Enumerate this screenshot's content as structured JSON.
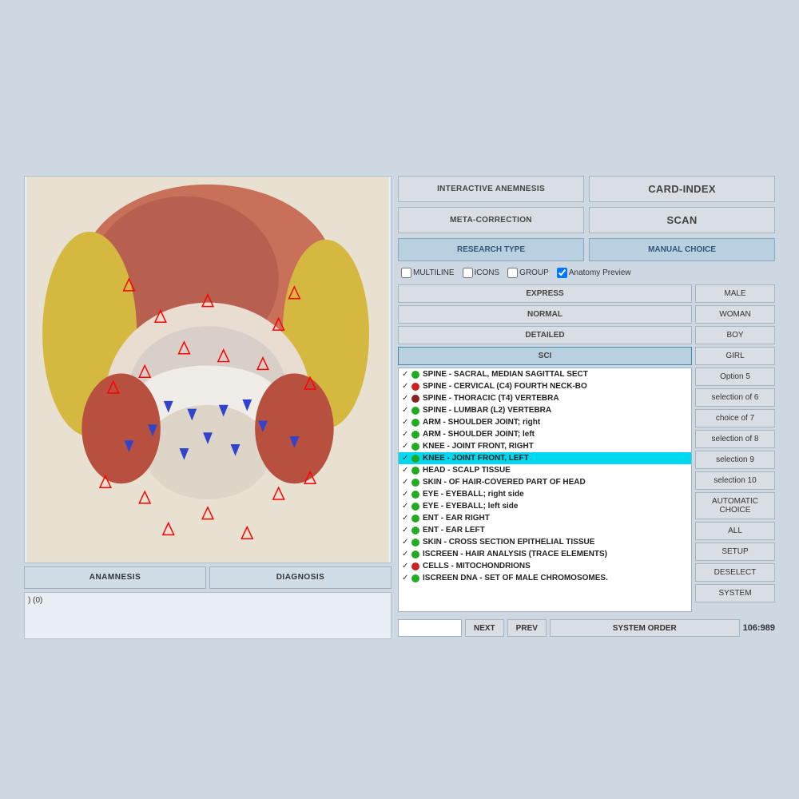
{
  "app": {
    "background_color": "#cdd8e3"
  },
  "top_buttons": {
    "interactive_anemnesis": "INTERACTIVE ANEMNESIS",
    "card_index": "CARD-INDEX",
    "meta_correction": "META-CORRECTION",
    "scan": "SCAN",
    "research_type": "RESEARCH TYPE",
    "manual_choice": "MANUAL CHOICE"
  },
  "checkboxes": {
    "multiline": "MULTILINE",
    "icons": "ICONS",
    "group": "GROUP",
    "anatomy_preview": "Anatomy Preview",
    "anatomy_preview_checked": true
  },
  "mode_buttons": {
    "express": "EXPRESS",
    "normal": "NORMAL",
    "detailed": "DETAILED",
    "sci": "SCI",
    "active": "SCI"
  },
  "anatomy_list": [
    {
      "checked": true,
      "dot": "green",
      "text": "SPINE - SACRAL, MEDIAN SAGITTAL SECT",
      "selected": false
    },
    {
      "checked": true,
      "dot": "red",
      "text": "SPINE - CERVICAL (C4) FOURTH NECK-BO",
      "selected": false
    },
    {
      "checked": true,
      "dot": "darkred",
      "text": "SPINE - THORACIC (T4) VERTEBRA",
      "selected": false
    },
    {
      "checked": true,
      "dot": "green",
      "text": "SPINE - LUMBAR (L2) VERTEBRA",
      "selected": false
    },
    {
      "checked": true,
      "dot": "green",
      "text": "ARM - SHOULDER JOINT; right",
      "selected": false
    },
    {
      "checked": true,
      "dot": "green",
      "text": "ARM - SHOULDER JOINT; left",
      "selected": false
    },
    {
      "checked": true,
      "dot": "green",
      "text": "KNEE - JOINT FRONT, RIGHT",
      "selected": false
    },
    {
      "checked": true,
      "dot": "green",
      "text": "KNEE - JOINT FRONT, LEFT",
      "selected": true
    },
    {
      "checked": true,
      "dot": "green",
      "text": "HEAD - SCALP TISSUE",
      "selected": false
    },
    {
      "checked": true,
      "dot": "green",
      "text": "SKIN - OF HAIR-COVERED PART OF HEAD",
      "selected": false
    },
    {
      "checked": true,
      "dot": "green",
      "text": "EYE - EYEBALL;  right side",
      "selected": false
    },
    {
      "checked": true,
      "dot": "green",
      "text": "EYE - EYEBALL;  left side",
      "selected": false
    },
    {
      "checked": true,
      "dot": "green",
      "text": "ENT - EAR RIGHT",
      "selected": false
    },
    {
      "checked": true,
      "dot": "green",
      "text": "ENT - EAR LEFT",
      "selected": false
    },
    {
      "checked": true,
      "dot": "green",
      "text": "SKIN - CROSS SECTION EPITHELIAL TISSUE",
      "selected": false
    },
    {
      "checked": true,
      "dot": "green",
      "text": "ISCREEN - HAIR ANALYSIS (TRACE ELEMENTS)",
      "selected": false
    },
    {
      "checked": true,
      "dot": "red",
      "text": "CELLS - MITOCHONDRIONS",
      "selected": false
    },
    {
      "checked": true,
      "dot": "green",
      "text": "ISCREEN DNA - SET OF MALE CHROMOSOMES.",
      "selected": false
    }
  ],
  "action_buttons": [
    "MALE",
    "WOMAN",
    "BOY",
    "GIRL",
    "Option 5",
    "selection of 6",
    "choice of 7",
    "selection of 8",
    "selection 9",
    "selection 10",
    "AUTOMATIC CHOICE",
    "ALL",
    "SETUP",
    "DESELECT",
    "SYSTEM"
  ],
  "bottom_buttons": {
    "anamnesis": "ANAMNESIS",
    "diagnosis": "DIAGNOSIS"
  },
  "status": {
    "text": ") (0)"
  },
  "navigation": {
    "next": "NEXT",
    "prev": "PREV",
    "system_order": "SYSTEM ORDER",
    "counter": "106:989"
  }
}
